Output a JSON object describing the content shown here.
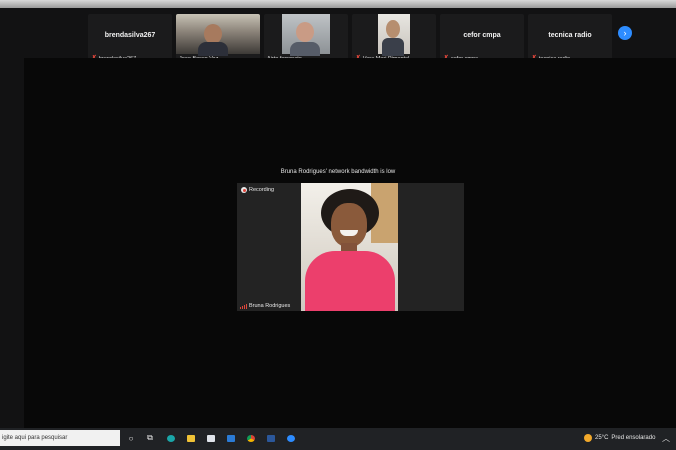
{
  "participants": [
    {
      "display": "brendasilva267",
      "name": "brendasilva267",
      "muted": true,
      "video": false
    },
    {
      "display": "",
      "name": "Joao Bosco Vaz",
      "muted": false,
      "video": true
    },
    {
      "display": "",
      "name": "Airto ferronato",
      "muted": false,
      "video": true
    },
    {
      "display": "",
      "name": "Vera Mari Pimentel",
      "muted": true,
      "video": true
    },
    {
      "display": "cefor cmpa",
      "name": "cefor cmpa",
      "muted": true,
      "video": false
    },
    {
      "display": "tecnica radio",
      "name": "tecnica radio",
      "muted": true,
      "video": false
    }
  ],
  "strip_next_icon": "chevron-right-icon",
  "notice": "Bruna Rodrigues' network bandwidth is low",
  "speaker": {
    "recording_label": "Recording",
    "name": "Bruna Rodrigues"
  },
  "taskbar": {
    "search_placeholder": "igite aqui para pesquisar",
    "temperature": "25°C",
    "weather": "Pred ensolarado",
    "icons": [
      "cortana-icon",
      "task-view-icon",
      "edge-icon",
      "file-explorer-icon",
      "store-icon",
      "mail-icon",
      "chrome-icon",
      "word-icon",
      "zoom-icon"
    ]
  },
  "colors": {
    "accent": "#2d8cff",
    "muted": "#e0453a",
    "shirt": "#ec3f6c"
  }
}
